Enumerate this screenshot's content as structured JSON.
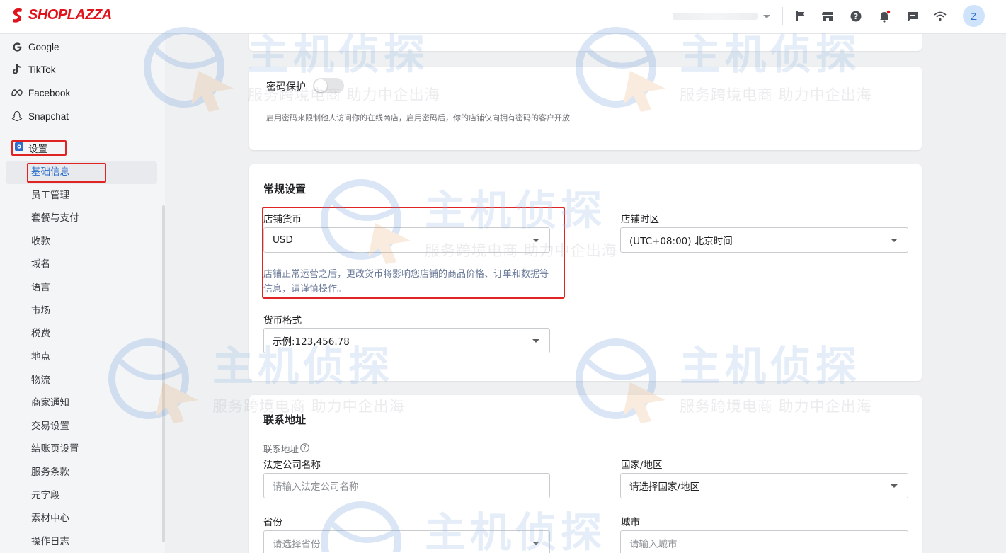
{
  "header": {
    "logo_text": "SHOPLAZZA",
    "avatar_initial": "Z",
    "icons": [
      "flag-icon",
      "store-icon",
      "help-icon",
      "bell-icon",
      "chat-icon",
      "wifi-icon"
    ],
    "accent_color": "#e0121b"
  },
  "sidebar": {
    "channels": [
      {
        "label": "Google",
        "icon": "google-icon"
      },
      {
        "label": "TikTok",
        "icon": "tiktok-icon"
      },
      {
        "label": "Facebook",
        "icon": "meta-icon"
      },
      {
        "label": "Snapchat",
        "icon": "snapchat-icon"
      }
    ],
    "settings_label": "设置",
    "items": [
      {
        "label": "基础信息",
        "active": true
      },
      {
        "label": "员工管理"
      },
      {
        "label": "套餐与支付"
      },
      {
        "label": "收款"
      },
      {
        "label": "域名"
      },
      {
        "label": "语言"
      },
      {
        "label": "市场"
      },
      {
        "label": "税费"
      },
      {
        "label": "地点"
      },
      {
        "label": "物流"
      },
      {
        "label": "商家通知"
      },
      {
        "label": "交易设置"
      },
      {
        "label": "结账页设置"
      },
      {
        "label": "服务条款"
      },
      {
        "label": "元字段"
      },
      {
        "label": "素材中心"
      },
      {
        "label": "操作日志"
      }
    ],
    "active_color": "#2c6ecb"
  },
  "password_card": {
    "title": "密码保护",
    "toggle_on": false,
    "description": "启用密码来限制他人访问你的在线商店，启用密码后，你的店铺仅向拥有密码的客户开放"
  },
  "general_card": {
    "title": "常规设置",
    "currency_label": "店铺货币",
    "currency_value": "USD",
    "currency_note": "店铺正常运营之后，更改货币将影响您店铺的商品价格、订单和数据等信息，请谨慎操作。",
    "timezone_label": "店铺时区",
    "timezone_value": "(UTC+08:00) 北京时间",
    "format_label": "货币格式",
    "format_value": "示例:123,456.78"
  },
  "contact_card": {
    "title": "联系地址",
    "subtitle": "联系地址",
    "company_label": "法定公司名称",
    "company_placeholder": "请输入法定公司名称",
    "country_label": "国家/地区",
    "country_value": "请选择国家/地区",
    "province_label": "省份",
    "province_placeholder": "请选择省份",
    "city_label": "城市",
    "city_placeholder": "请输入城市"
  },
  "watermark": {
    "big": "主机侦探",
    "small": "服务跨境电商 助力中企出海"
  }
}
